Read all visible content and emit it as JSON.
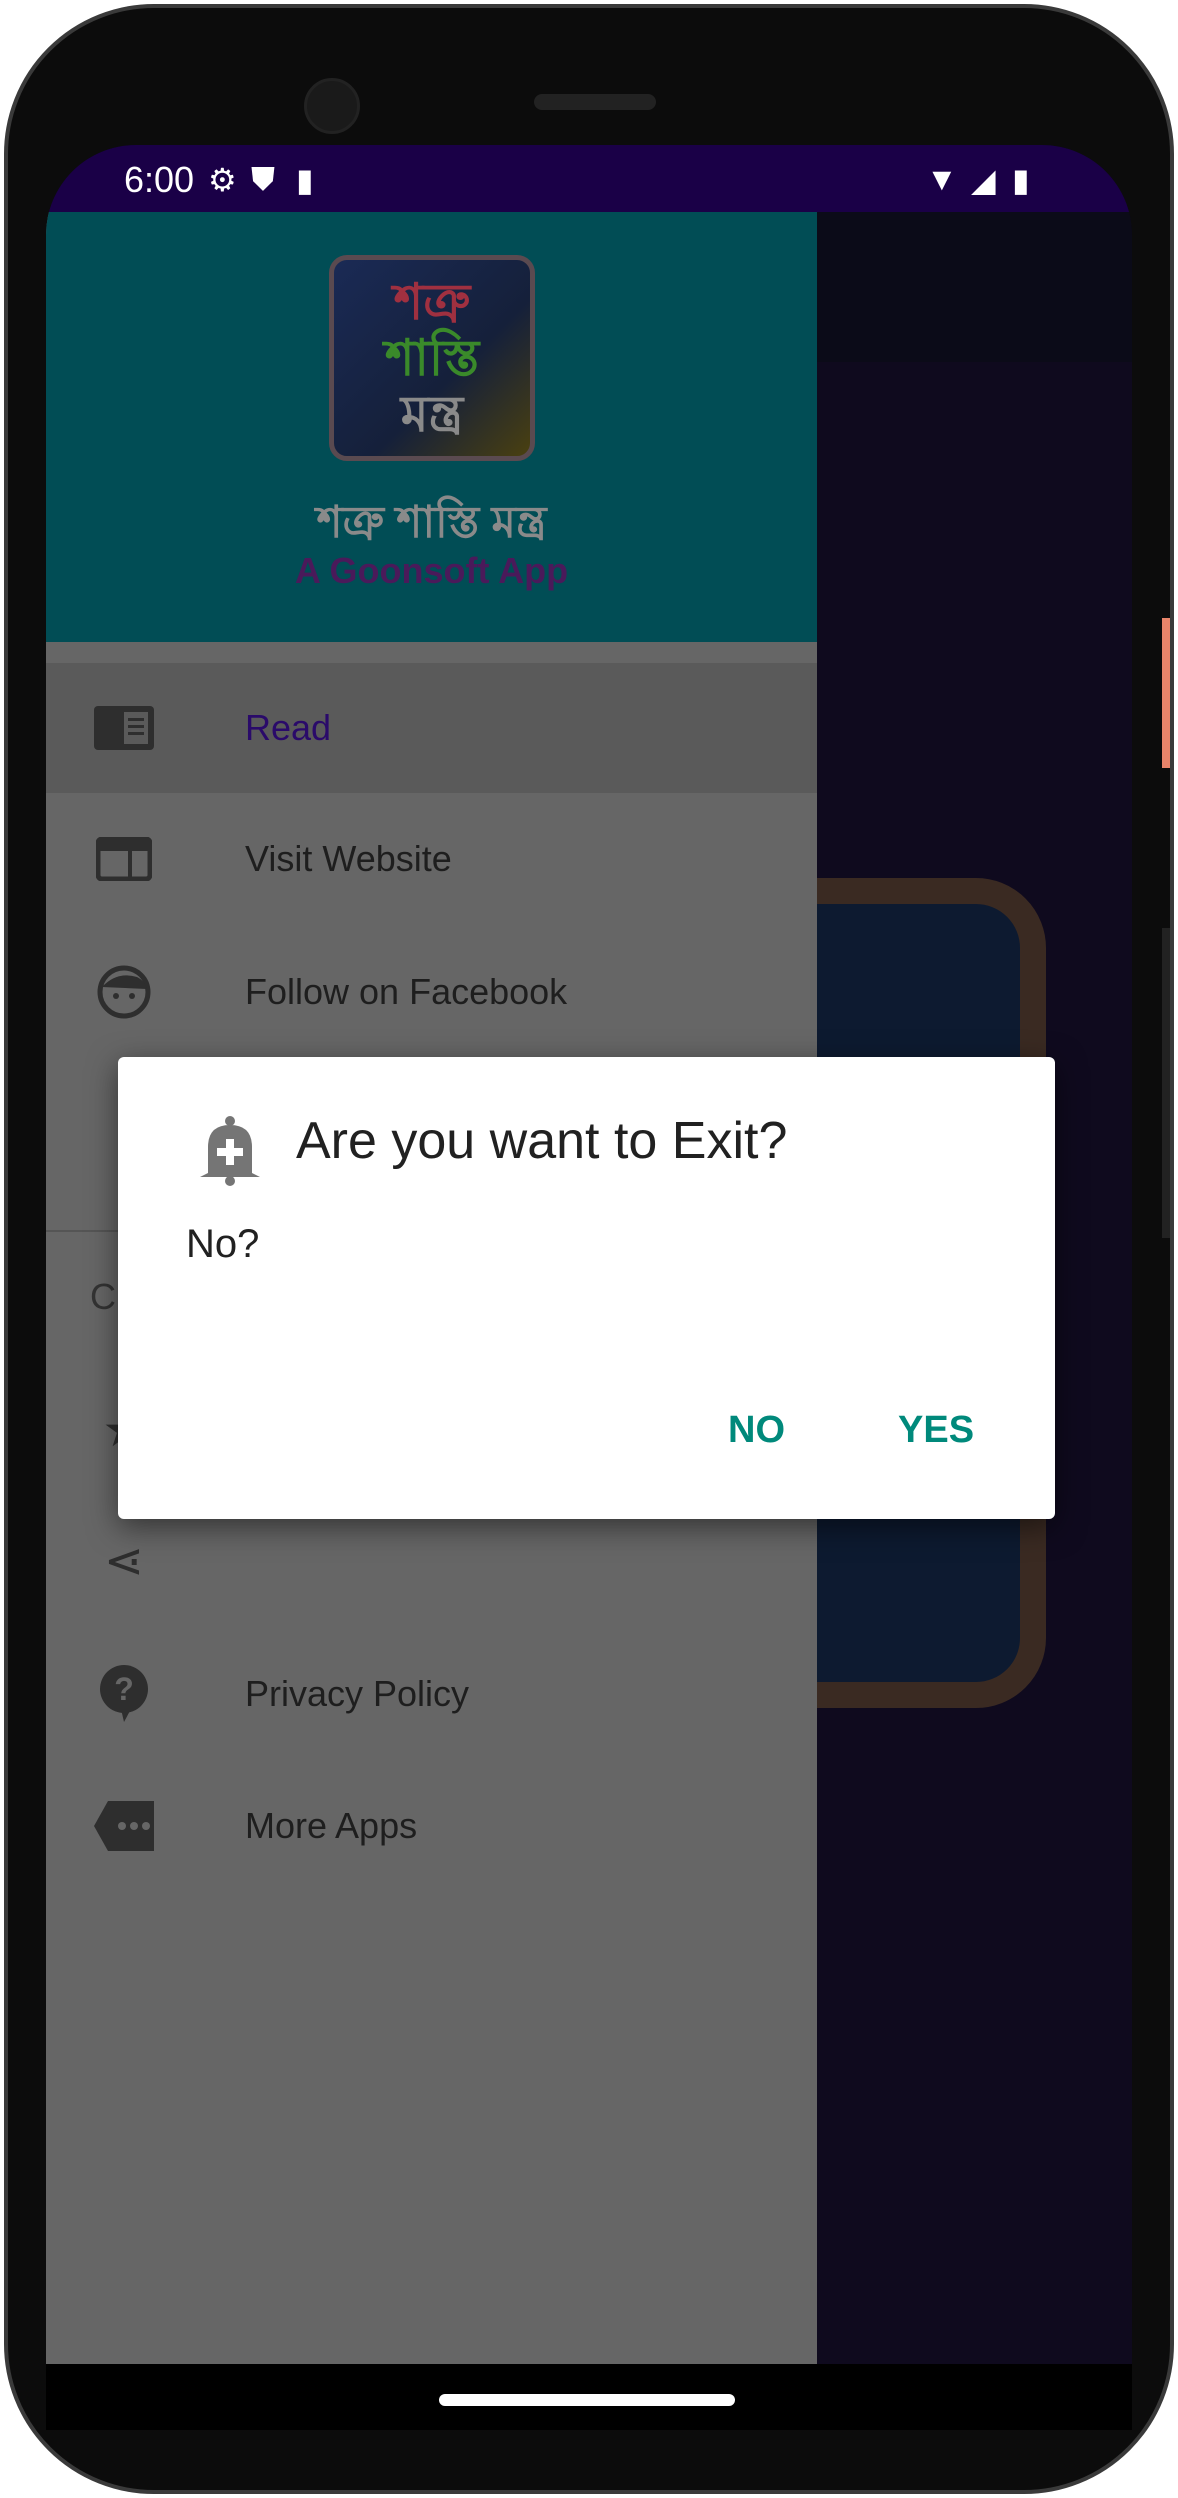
{
  "status_bar": {
    "time": "6:00",
    "icons": [
      "gear-icon",
      "shield-play-icon",
      "sd-card-icon",
      "wifi-icon",
      "signal-icon",
      "battery-icon"
    ]
  },
  "drawer": {
    "logo_lines": [
      "শত্রু",
      "শাস্তি",
      "মন্ত্র"
    ],
    "app_title": "শত্রু শাস্তি মন্ত্র",
    "app_subtitle": "A Goonsoft App",
    "items": [
      {
        "label": "Read",
        "icon": "book-icon",
        "selected": true
      },
      {
        "label": "Visit Website",
        "icon": "web-icon"
      },
      {
        "label": "Follow on Facebook",
        "icon": "face-icon"
      }
    ],
    "section_partial": "C",
    "lower_items": [
      {
        "label": "",
        "icon": "star-icon"
      },
      {
        "label": "",
        "icon": "share-icon"
      },
      {
        "label": "Privacy Policy",
        "icon": "help-icon"
      },
      {
        "label": "More Apps",
        "icon": "more-icon"
      }
    ]
  },
  "dialog": {
    "title": "Are you want to Exit?",
    "message": "No?",
    "negative": "NO",
    "positive": "YES",
    "icon": "bell-plus-icon"
  },
  "colors": {
    "status_bar": "#1a0047",
    "drawer_header": "#014d55",
    "accent": "#00897b",
    "selected_text": "#2a0a6a"
  }
}
